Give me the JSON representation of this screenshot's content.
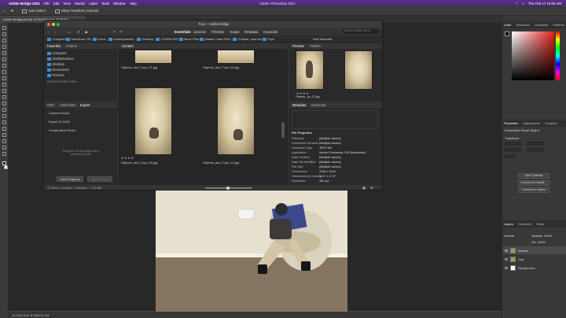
{
  "menubar": {
    "app": "Adobe Bridge 2021",
    "items": [
      "File",
      "Edit",
      "View",
      "Stacks",
      "Label",
      "Tools",
      "Window",
      "Help"
    ],
    "window_title": "Adobe Photoshop 2021",
    "clock": "Thu Feb 17 10:05 AM"
  },
  "ps": {
    "auto_select": "Auto-Select:",
    "transform_controls": "Show Transform Controls",
    "doc_tab": "Adobe Bridge.psd @ 13.3% (Blanket, RGB/8*)",
    "status": "13.34%   Doc: 8.99M/36.1M"
  },
  "bridge": {
    "title": "Toys – Adobe Bridge",
    "workspaces": [
      "Essentials",
      "Libraries",
      "Filmstrip",
      "Output",
      "Metadata",
      "Keywords"
    ],
    "active_workspace": "Essentials",
    "search_placeholder": "Search Adobe Stock",
    "sort_label": "Sort Manually",
    "path": [
      "Computer",
      "Macintosh HD",
      "Users",
      "bradleyhansen",
      "Desktop",
      "CIS368 W22",
      "Book Files",
      "Master Class Files",
      "Chapter_sources",
      "Toys"
    ],
    "left_tabs": [
      "Favorites",
      "Folders"
    ],
    "favorites": [
      "Computer",
      "bradleyhansen",
      "Desktop",
      "Documents",
      "Pictures"
    ],
    "drag_hint": "Drag Favorites Here...",
    "export_tabs": [
      "Filter",
      "Collections",
      "Export"
    ],
    "export_items": [
      "Custom Export",
      "Export To DNG",
      "Create New Preset"
    ],
    "export_drop_hint": "Drag and Drop images on a preset to export",
    "view_progress": "View Progress",
    "start_export": "Start Export",
    "content_tab": "Content",
    "thumbs": [
      {
        "name": "Objects_and_Toys_07.jpg"
      },
      {
        "name": "Objects_and_Toys_08.jpg"
      },
      {
        "name": "Objects_and_Toys_09.jpg"
      },
      {
        "name": "Objects_and_Toys_10.jpg"
      }
    ],
    "preview_tabs": [
      "Preview",
      "Publish"
    ],
    "preview_caption": "Objects...ys_07.jpg",
    "meta_tabs": [
      "Metadata",
      "Keywords"
    ],
    "file_props_header": "File Properties",
    "meta": [
      [
        "Filename",
        "(Multiple values)"
      ],
      [
        "Preserved Filename",
        "(Multiple values)"
      ],
      [
        "Document Type",
        "JPEG file"
      ],
      [
        "Application",
        "Adobe Photoshop CS6 (Macintosh)"
      ],
      [
        "Date Created",
        "(Multiple values)"
      ],
      [
        "Date File Modified",
        "(Multiple values)"
      ],
      [
        "File Size",
        "(Multiple values)"
      ],
      [
        "Dimensions",
        "2436 x 3144"
      ],
      [
        "Dimensions (in inches)",
        "11.0\" x 17.5\""
      ],
      [
        "Resolution",
        "300 ppi"
      ]
    ],
    "status": "17 items, 1 hidden, 2 selected – 4.72 MB"
  },
  "panels": {
    "color_tabs": [
      "Color",
      "Swatches",
      "Gradients",
      "Patterns"
    ],
    "props_tabs": [
      "Properties",
      "Adjustments",
      "Libraries"
    ],
    "props_title": "Embedded Smart Object",
    "transform": "Transform",
    "edit_contents": "Edit Contents",
    "convert_linked": "Convert to Linked...",
    "convert_layers": "Convert to Layers",
    "layers_tabs": [
      "Layers",
      "Channels",
      "Paths"
    ],
    "blend": "Normal",
    "opacity": "Opacity: 100%",
    "fill": "Fill: 100%",
    "layers": [
      "Blanket",
      "Dad",
      "Background"
    ]
  }
}
